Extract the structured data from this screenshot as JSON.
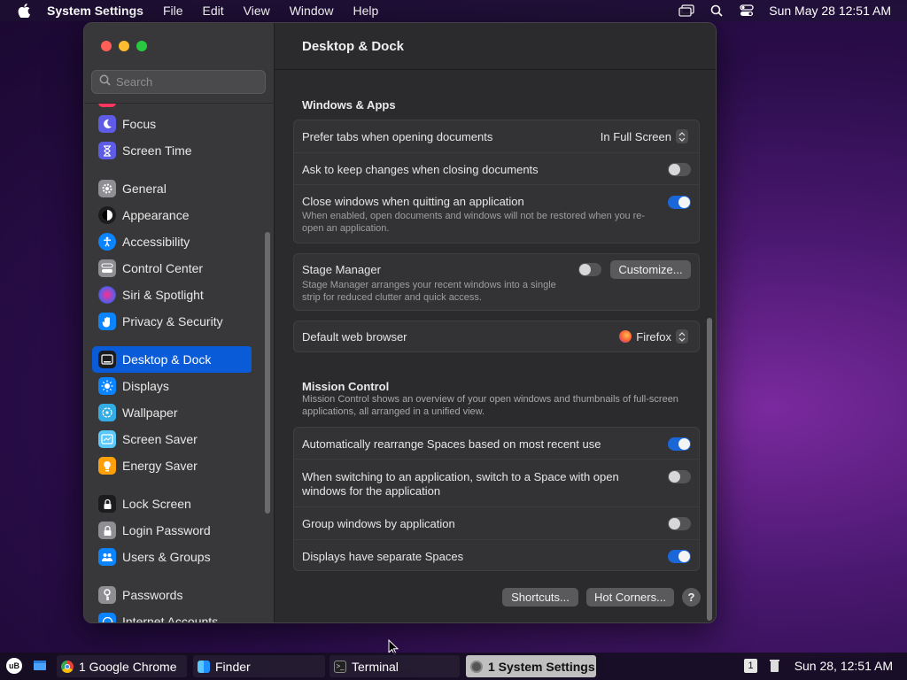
{
  "menubar": {
    "app_name": "System Settings",
    "menus": [
      "File",
      "Edit",
      "View",
      "Window",
      "Help"
    ],
    "clock": "Sun May 28  12:51 AM"
  },
  "window": {
    "title": "Desktop & Dock",
    "search_placeholder": "Search"
  },
  "sidebar": {
    "items": [
      {
        "label": "Focus",
        "icon": "moon-icon",
        "color": "#5e5ce6"
      },
      {
        "label": "Screen Time",
        "icon": "hourglass-icon",
        "color": "#5e5ce6"
      },
      {
        "label": "General",
        "icon": "gear-icon",
        "color": "#8e8e93"
      },
      {
        "label": "Appearance",
        "icon": "appearance-icon",
        "color": "#1c1c1e"
      },
      {
        "label": "Accessibility",
        "icon": "accessibility-icon",
        "color": "#0a84ff"
      },
      {
        "label": "Control Center",
        "icon": "control-center-icon",
        "color": "#8e8e93"
      },
      {
        "label": "Siri & Spotlight",
        "icon": "siri-icon",
        "color": "#bf5af2"
      },
      {
        "label": "Privacy & Security",
        "icon": "hand-icon",
        "color": "#0a84ff"
      },
      {
        "label": "Desktop & Dock",
        "icon": "dock-icon",
        "color": "#1c1c1e"
      },
      {
        "label": "Displays",
        "icon": "sun-icon",
        "color": "#0a84ff"
      },
      {
        "label": "Wallpaper",
        "icon": "wallpaper-icon",
        "color": "#32ade6"
      },
      {
        "label": "Screen Saver",
        "icon": "screen-saver-icon",
        "color": "#5ac8fa"
      },
      {
        "label": "Energy Saver",
        "icon": "bulb-icon",
        "color": "#ff9f0a"
      },
      {
        "label": "Lock Screen",
        "icon": "lock-icon",
        "color": "#1c1c1e"
      },
      {
        "label": "Login Password",
        "icon": "lock-icon",
        "color": "#8e8e93"
      },
      {
        "label": "Users & Groups",
        "icon": "users-icon",
        "color": "#0a84ff"
      },
      {
        "label": "Passwords",
        "icon": "key-icon",
        "color": "#8e8e93"
      },
      {
        "label": "Internet Accounts",
        "icon": "at-icon",
        "color": "#0a84ff"
      }
    ]
  },
  "windows_apps": {
    "title": "Windows & Apps",
    "prefer_tabs_label": "Prefer tabs when opening documents",
    "prefer_tabs_value": "In Full Screen",
    "ask_keep_label": "Ask to keep changes when closing documents",
    "ask_keep_on": false,
    "close_windows_label": "Close windows when quitting an application",
    "close_windows_desc": "When enabled, open documents and windows will not be restored when you re-open an application.",
    "close_windows_on": true,
    "stage_manager_label": "Stage Manager",
    "stage_manager_desc": "Stage Manager arranges your recent windows into a single strip for reduced clutter and quick access.",
    "stage_manager_on": false,
    "customize_label": "Customize...",
    "default_browser_label": "Default web browser",
    "default_browser_value": "Firefox"
  },
  "mission_control": {
    "title": "Mission Control",
    "desc": "Mission Control shows an overview of your open windows and thumbnails of full-screen applications, all arranged in a unified view.",
    "auto_rearrange_label": "Automatically rearrange Spaces based on most recent use",
    "auto_rearrange_on": true,
    "switch_space_label": "When switching to an application, switch to a Space with open windows for the application",
    "switch_space_on": false,
    "group_windows_label": "Group windows by application",
    "group_windows_on": false,
    "separate_spaces_label": "Displays have separate Spaces",
    "separate_spaces_on": true,
    "shortcuts_label": "Shortcuts...",
    "hot_corners_label": "Hot Corners...",
    "help_label": "?"
  },
  "taskbar": {
    "ub_label": "uB",
    "chrome_label": "1 Google Chrome",
    "finder_label": "Finder",
    "terminal_label": "Terminal",
    "settings_label": "1 System Settings",
    "workspace_label": "1",
    "clock": "Sun 28, 12:51 AM"
  }
}
